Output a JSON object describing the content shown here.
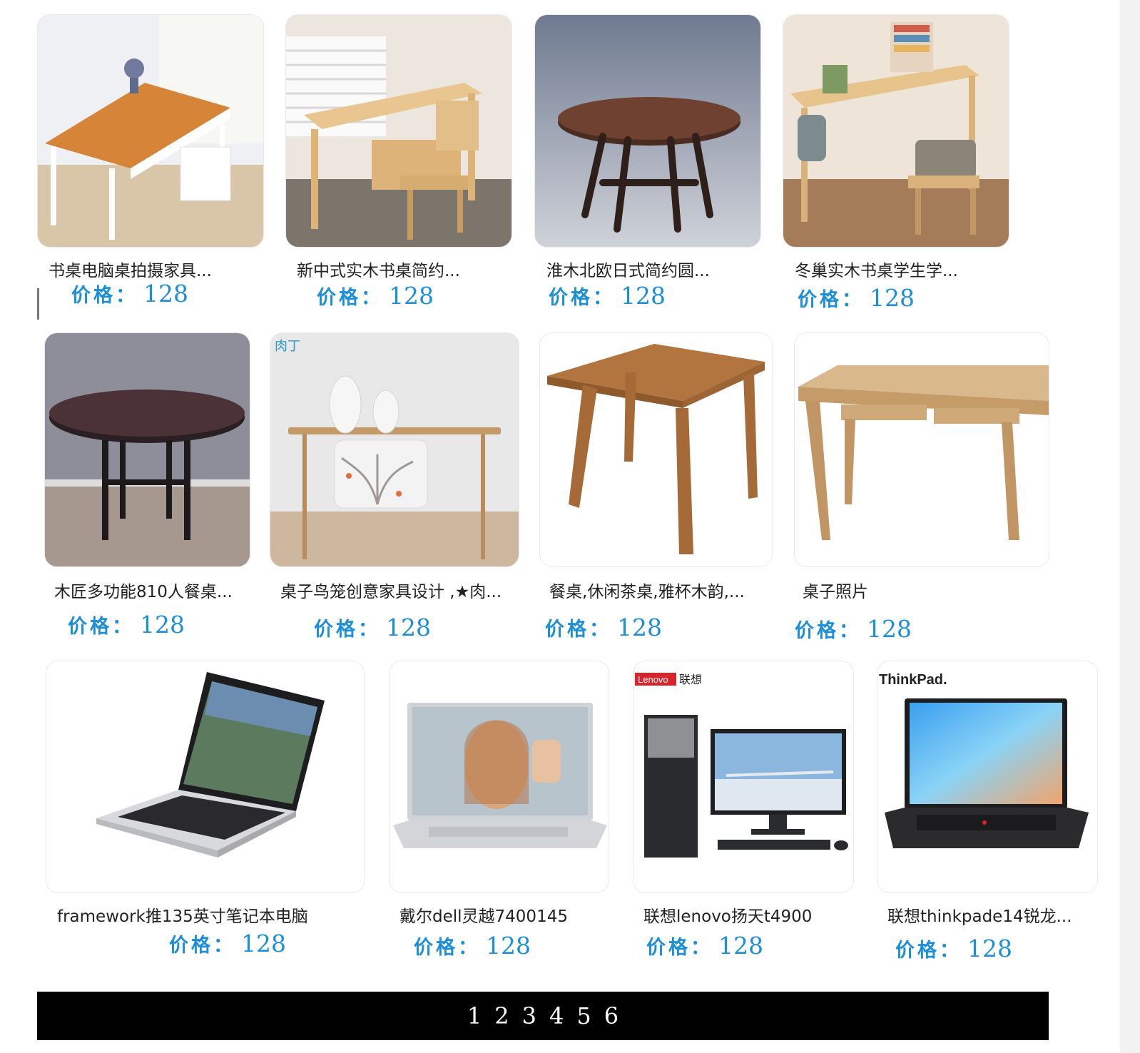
{
  "products": [
    {
      "title": "书桌电脑桌拍摄家具...",
      "price_label": "价格",
      "price_colon": "：",
      "price": "128",
      "image_icon": "desk-white-orange-icon"
    },
    {
      "title": "新中式实木书桌简约...",
      "price_label": "价格",
      "price_colon": "：",
      "price": "128",
      "image_icon": "desk-wood-chair-icon"
    },
    {
      "title": "淮木北欧日式简约圆...",
      "price_label": "价格",
      "price_colon": "：",
      "price": "128",
      "image_icon": "round-dark-table-icon"
    },
    {
      "title": "冬巢实木书桌学生学...",
      "price_label": "价格",
      "price_colon": "：",
      "price": "128",
      "image_icon": "desk-chair-books-icon"
    },
    {
      "title": "木匠多功能810人餐桌...",
      "price_label": "价格",
      "price_colon": "：",
      "price": "128",
      "image_icon": "round-dining-table-icon"
    },
    {
      "title": "桌子鸟笼创意家具设计 ,★肉...",
      "price_label": "价格",
      "price_colon": "：",
      "price": "128",
      "image_icon": "console-table-icon",
      "image_logo": "肉丁"
    },
    {
      "title": "餐桌,休闲茶桌,雅杯木韵,...",
      "price_label": "价格",
      "price_colon": "：",
      "price": "128",
      "image_icon": "square-tea-table-icon"
    },
    {
      "title": "桌子照片",
      "price_label": "价格",
      "price_colon": "：",
      "price": "128",
      "image_icon": "rustic-desk-icon"
    },
    {
      "title": "framework推135英寸笔记本电脑",
      "price_label": "价格",
      "price_colon": "：",
      "price": "128",
      "image_icon": "laptop-silver-icon"
    },
    {
      "title": "戴尔dell灵越7400145",
      "price_label": "价格",
      "price_colon": "：",
      "price": "128",
      "image_icon": "laptop-dell-icon"
    },
    {
      "title": "联想lenovo扬天t4900",
      "price_label": "价格",
      "price_colon": "：",
      "price": "128",
      "image_icon": "desktop-pc-icon",
      "image_logo": "Lenovo",
      "image_logo_cn": "联想"
    },
    {
      "title": "联想thinkpade14锐龙...",
      "price_label": "价格",
      "price_colon": "：",
      "price": "128",
      "image_icon": "laptop-thinkpad-icon",
      "image_logo": "ThinkPad."
    }
  ],
  "pagination": {
    "pages": [
      "1",
      "2",
      "3",
      "4",
      "5",
      "6"
    ]
  },
  "colors": {
    "price": "#1c8fd8",
    "pagination_bg": "#000000",
    "pagination_text": "#ffffff"
  }
}
